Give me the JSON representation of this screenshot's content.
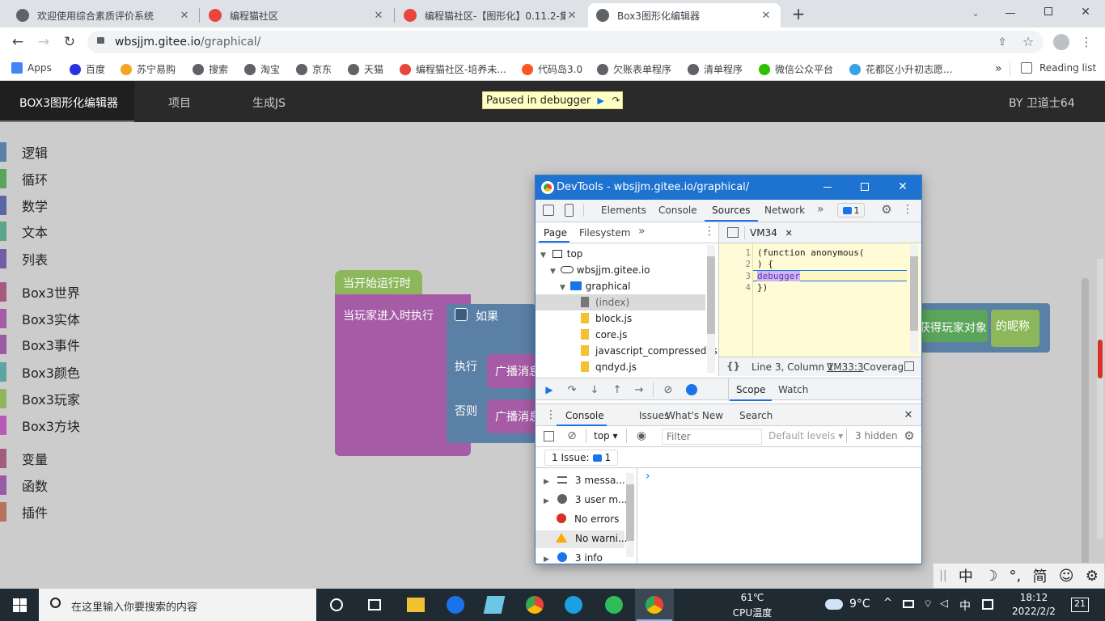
{
  "tabs": [
    {
      "title": "欢迎使用综合素质评价系统",
      "fav": "#5f6368"
    },
    {
      "title": "编程猫社区",
      "fav": "#e8453c"
    },
    {
      "title": "编程猫社区-【图形化】0.11.2-集",
      "fav": "#e8453c"
    },
    {
      "title": "Box3图形化编辑器",
      "fav": "#5f6368"
    }
  ],
  "tab_close": "✕",
  "new_tab": "+",
  "address": {
    "host": "wbsjjm.gitee.io",
    "path": "/graphical/"
  },
  "bookmarks": [
    {
      "label": "Apps",
      "color": "#4285f4"
    },
    {
      "label": "百度",
      "color": "#2932e1"
    },
    {
      "label": "苏宁易购",
      "color": "#f5a623"
    },
    {
      "label": "搜索",
      "color": "#5f6368"
    },
    {
      "label": "淘宝",
      "color": "#5f6368"
    },
    {
      "label": "京东",
      "color": "#5f6368"
    },
    {
      "label": "天猫",
      "color": "#5f6368"
    },
    {
      "label": "编程猫社区-培养未...",
      "color": "#e8453c"
    },
    {
      "label": "代码岛3.0",
      "color": "#ff5722"
    },
    {
      "label": "欠账表单程序",
      "color": "#5f6368"
    },
    {
      "label": "清单程序",
      "color": "#5f6368"
    },
    {
      "label": "微信公众平台",
      "color": "#2dc100"
    },
    {
      "label": "花都区小升初志愿...",
      "color": "#3aa0e8"
    }
  ],
  "bookmarks_more": "»",
  "reading_list": "Reading list",
  "app": {
    "brand": "BOX3图形化编辑器",
    "nav": [
      "项目",
      "生成JS"
    ],
    "author": "BY 卫道士64",
    "debugger_banner": "Paused in debugger"
  },
  "categories": [
    {
      "label": "逻辑",
      "color": "#5b80a5"
    },
    {
      "label": "循环",
      "color": "#5ba55b"
    },
    {
      "label": "数学",
      "color": "#5b67a5"
    },
    {
      "label": "文本",
      "color": "#5ba58c"
    },
    {
      "label": "列表",
      "color": "#745ba5"
    },
    {
      "label": "Box3世界",
      "color": "#a55b80"
    },
    {
      "label": "Box3实体",
      "color": "#a55ba5"
    },
    {
      "label": "Box3事件",
      "color": "#995ba5"
    },
    {
      "label": "Box3颜色",
      "color": "#5ba5a5"
    },
    {
      "label": "Box3玩家",
      "color": "#8cb85b"
    },
    {
      "label": "Box3方块",
      "color": "#b85bb8"
    },
    {
      "label": "变量",
      "color": "#a55b80"
    },
    {
      "label": "函数",
      "color": "#995ba5"
    },
    {
      "label": "插件",
      "color": "#b8735b"
    }
  ],
  "blocks": {
    "hat": "当开始运行时",
    "event": "当玩家进入时执行",
    "if": "如果",
    "do": "执行",
    "else": "否则",
    "broadcast1": "广播消息",
    "broadcast2": "广播消息",
    "get_player": "获得玩家对象",
    "nickname": "的昵称"
  },
  "devtools": {
    "title": "DevTools - wbsjjm.gitee.io/graphical/",
    "tabs": [
      "Elements",
      "Console",
      "Sources",
      "Network"
    ],
    "issues_count": "1",
    "nav_tabs": [
      "Page",
      "Filesystem"
    ],
    "tree": [
      {
        "label": "top",
        "depth": 0,
        "type": "frame"
      },
      {
        "label": "wbsjjm.gitee.io",
        "depth": 1,
        "type": "cloud"
      },
      {
        "label": "graphical",
        "depth": 2,
        "type": "folder"
      },
      {
        "label": "(index)",
        "depth": 3,
        "type": "doc"
      },
      {
        "label": "block.js",
        "depth": 3,
        "type": "file"
      },
      {
        "label": "core.js",
        "depth": 3,
        "type": "file"
      },
      {
        "label": "javascript_compressed.js",
        "depth": 3,
        "type": "file"
      },
      {
        "label": "qndyd.js",
        "depth": 3,
        "type": "file"
      }
    ],
    "editor_tab": "VM34",
    "code": [
      {
        "n": "1",
        "t": "(function anonymous("
      },
      {
        "n": "2",
        "t": ") {"
      },
      {
        "n": "3",
        "t": "debugger"
      },
      {
        "n": "4",
        "t": "})"
      }
    ],
    "status": {
      "pos": "Line 3, Column 1",
      "link": "VM33:3",
      "coverage": "Coverag"
    },
    "scope_tabs": [
      "Scope",
      "Watch"
    ],
    "drawer_tabs": [
      "Console",
      "Issues",
      "What's New",
      "Search"
    ],
    "console": {
      "context": "top",
      "filter_placeholder": "Filter",
      "levels": "Default levels",
      "hidden": "3 hidden",
      "issue_label": "1 Issue:",
      "issue_count": "1",
      "sidebar": [
        {
          "label": "3 messa...",
          "icon": "list"
        },
        {
          "label": "3 user m...",
          "icon": "user"
        },
        {
          "label": "No errors",
          "icon": "error"
        },
        {
          "label": "No warni...",
          "icon": "warning"
        },
        {
          "label": "3 info",
          "icon": "info"
        }
      ],
      "prompt": "›"
    }
  },
  "ime": {
    "items": [
      "中",
      "☽",
      "°,",
      "简",
      "☺",
      "⚙"
    ]
  },
  "taskbar": {
    "search_placeholder": "在这里输入你要搜索的内容",
    "temp_value": "61℃",
    "temp_label": "CPU温度",
    "weather": "9°C",
    "ime": "中",
    "time": "18:12",
    "date": "2022/2/2",
    "notifications": "21"
  }
}
